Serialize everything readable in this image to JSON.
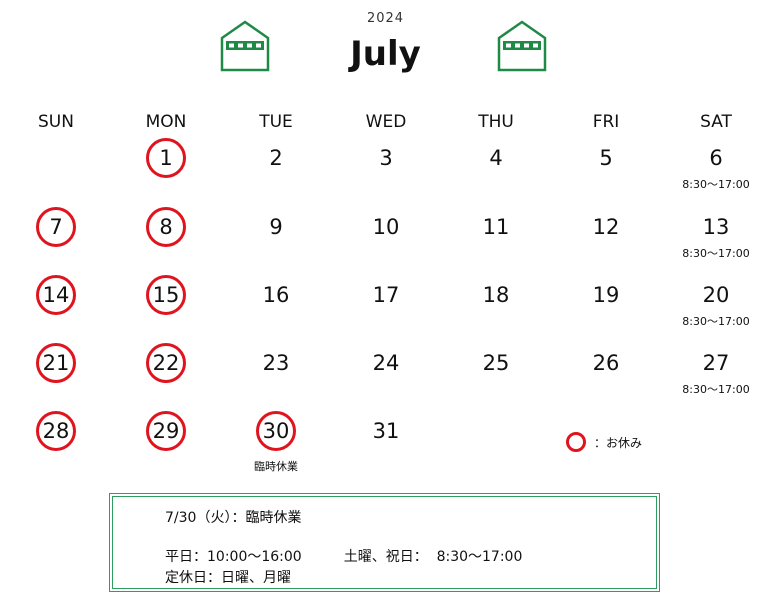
{
  "header": {
    "year": "2024",
    "month": "July",
    "icon": "house-icon",
    "accent_color": "#1e8a46"
  },
  "weekdays": [
    "SUN",
    "MON",
    "TUE",
    "WED",
    "THU",
    "FRI",
    "SAT"
  ],
  "holiday_color": "#e0141e",
  "weeks": [
    [
      null,
      {
        "d": "1",
        "off": true
      },
      {
        "d": "2"
      },
      {
        "d": "3"
      },
      {
        "d": "4"
      },
      {
        "d": "5"
      },
      {
        "d": "6",
        "note": "8:30～17:00"
      }
    ],
    [
      {
        "d": "7",
        "off": true
      },
      {
        "d": "8",
        "off": true
      },
      {
        "d": "9"
      },
      {
        "d": "10"
      },
      {
        "d": "11"
      },
      {
        "d": "12"
      },
      {
        "d": "13",
        "note": "8:30～17:00"
      }
    ],
    [
      {
        "d": "14",
        "off": true
      },
      {
        "d": "15",
        "off": true
      },
      {
        "d": "16"
      },
      {
        "d": "17"
      },
      {
        "d": "18"
      },
      {
        "d": "19"
      },
      {
        "d": "20",
        "note": "8:30～17:00"
      }
    ],
    [
      {
        "d": "21",
        "off": true
      },
      {
        "d": "22",
        "off": true
      },
      {
        "d": "23"
      },
      {
        "d": "24"
      },
      {
        "d": "25"
      },
      {
        "d": "26"
      },
      {
        "d": "27",
        "note": "8:30～17:00"
      }
    ],
    [
      {
        "d": "28",
        "off": true
      },
      {
        "d": "29",
        "off": true
      },
      {
        "d": "30",
        "off": true,
        "note": "臨時休業"
      },
      {
        "d": "31"
      },
      null,
      null,
      null
    ]
  ],
  "legend": {
    "label": "：お休み"
  },
  "info": {
    "line1": "7/30（火）：臨時休業",
    "line2": "平日：10:00～16:00　　　土曜、祝日：  8:30～17:00",
    "line3": "定休日：日曜、月曜",
    "border_color": "#2e9e5e"
  }
}
